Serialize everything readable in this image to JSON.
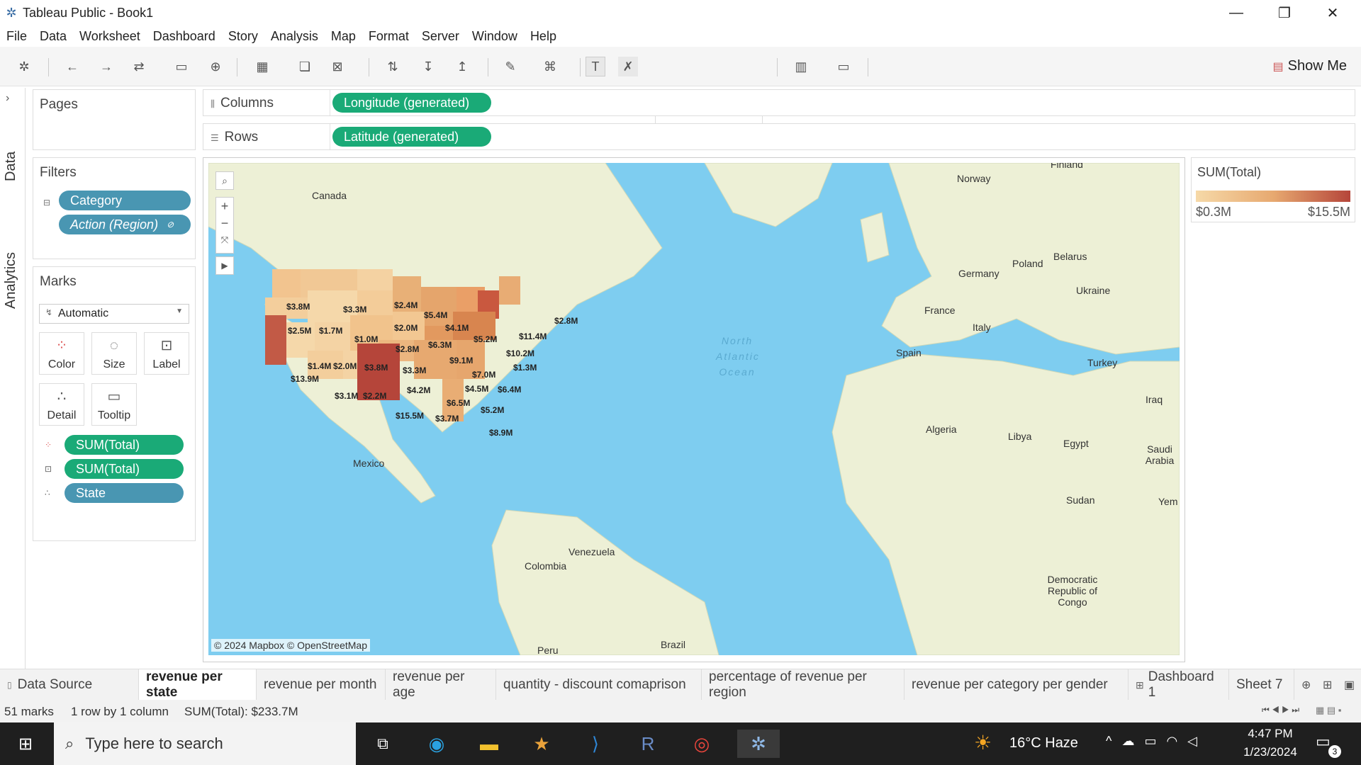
{
  "window": {
    "title": "Tableau Public - Book1"
  },
  "menu": [
    "File",
    "Data",
    "Worksheet",
    "Dashboard",
    "Story",
    "Analysis",
    "Map",
    "Format",
    "Server",
    "Window",
    "Help"
  ],
  "toolbar": {
    "show_me": "Show Me"
  },
  "side_tabs": {
    "data": "Data",
    "analytics": "Analytics"
  },
  "pages": {
    "title": "Pages"
  },
  "filters": {
    "title": "Filters",
    "items": [
      "Category",
      "Action (Region)"
    ]
  },
  "marks": {
    "title": "Marks",
    "type": "Automatic",
    "buttons": [
      "Color",
      "Size",
      "Label",
      "Detail",
      "Tooltip"
    ],
    "pills": [
      "SUM(Total)",
      "SUM(Total)",
      "State"
    ]
  },
  "shelves": {
    "columns_label": "Columns",
    "columns_pill": "Longitude (generated)",
    "rows_label": "Rows",
    "rows_pill": "Latitude (generated)"
  },
  "legend": {
    "title": "SUM(Total)",
    "min": "$0.3M",
    "max": "$15.5M"
  },
  "map": {
    "attribution": "© 2024 Mapbox © OpenStreetMap",
    "ocean": "North Atlantic Ocean",
    "places": [
      "Canada",
      "Mexico",
      "Venezuela",
      "Colombia",
      "Peru",
      "Brazil",
      "Norway",
      "Finland",
      "Poland",
      "Belarus",
      "Germany",
      "Ukraine",
      "France",
      "Italy",
      "Spain",
      "Turkey",
      "Iraq",
      "Algeria",
      "Libya",
      "Egypt",
      "Saudi Arabia",
      "Sudan",
      "Yem",
      "Democratic Republic of Congo"
    ],
    "state_labels": [
      "$3.8M",
      "$3.3M",
      "$2.4M",
      "$5.4M",
      "$2.5M",
      "$1.7M",
      "$2.0M",
      "$4.1M",
      "$1.0M",
      "$2.8M",
      "$6.3M",
      "$5.2M",
      "$11.4M",
      "$2.8M",
      "$1.4M",
      "$2.0M",
      "$3.8M",
      "$3.3M",
      "$9.1M",
      "$10.2M",
      "$13.9M",
      "$4.2M",
      "$7.0M",
      "$1.3M",
      "$3.1M",
      "$2.2M",
      "$4.5M",
      "$6.4M",
      "$6.5M",
      "$15.5M",
      "$3.7M",
      "$5.2M",
      "$8.9M"
    ]
  },
  "sheet_tabs": [
    "Data Source",
    "revenue per state",
    "revenue per month",
    "revenue per age",
    "quantity - discount comaprison",
    "percentage of revenue per region",
    "revenue per category per gender",
    "Dashboard 1",
    "Sheet 7"
  ],
  "active_tab": "revenue per state",
  "status": {
    "marks": "51 marks",
    "layout": "1 row by 1 column",
    "sum": "SUM(Total): $233.7M"
  },
  "taskbar": {
    "search_placeholder": "Type here to search",
    "weather": "16°C  Haze",
    "time": "4:47 PM",
    "date": "1/23/2024",
    "notifications": "3"
  },
  "colors": {
    "pill_blue": "#4996b2",
    "pill_green": "#1aaa77",
    "legend_low": "#f6d9a8",
    "legend_high": "#b5453a",
    "ocean": "#7ecdf0",
    "land": "#edf0d6"
  }
}
